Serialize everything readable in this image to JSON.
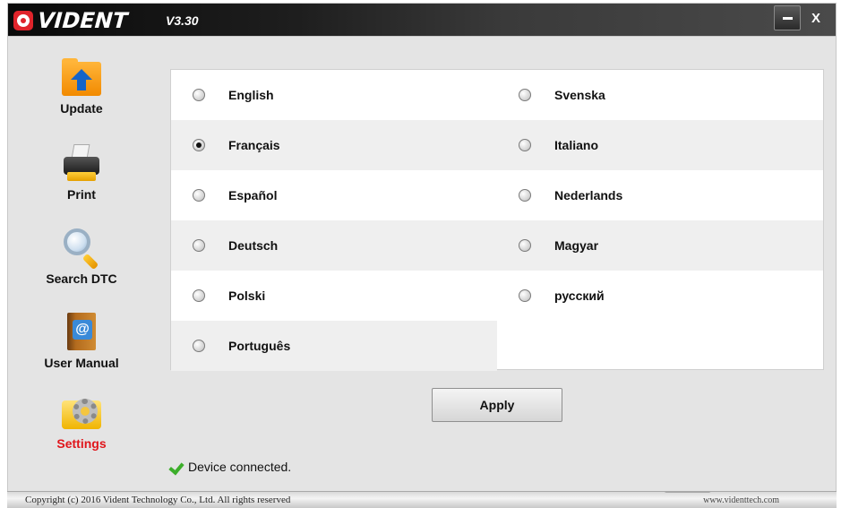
{
  "app": {
    "logo_text": "VIDENT",
    "version": "V3.30",
    "minimize_label": "",
    "close_label": "X"
  },
  "sidebar": {
    "items": [
      {
        "label": "Update",
        "icon": "update-folder-icon"
      },
      {
        "label": "Print",
        "icon": "printer-icon"
      },
      {
        "label": "Search DTC",
        "icon": "magnifier-icon"
      },
      {
        "label": "User Manual",
        "icon": "address-book-icon"
      },
      {
        "label": "Settings",
        "icon": "settings-gear-icon",
        "active": true
      }
    ]
  },
  "languages": {
    "left": [
      "English",
      "Français",
      "Español",
      "Deutsch",
      "Polski",
      "Português"
    ],
    "right": [
      "Svenska",
      "Italiano",
      "Nederlands",
      "Magyar",
      "русский"
    ],
    "selected": "Français"
  },
  "apply_label": "Apply",
  "status": {
    "text": "Device connected.",
    "icon": "check-icon"
  },
  "footer": {
    "copyright": "Copyright (c) 2016 Vident Technology Co., Ltd. All rights reserved",
    "website": "www.videnttech.com"
  },
  "colors": {
    "brand_red": "#e0242b",
    "active_nav": "#e0151b",
    "status_green": "#3cae2a"
  }
}
